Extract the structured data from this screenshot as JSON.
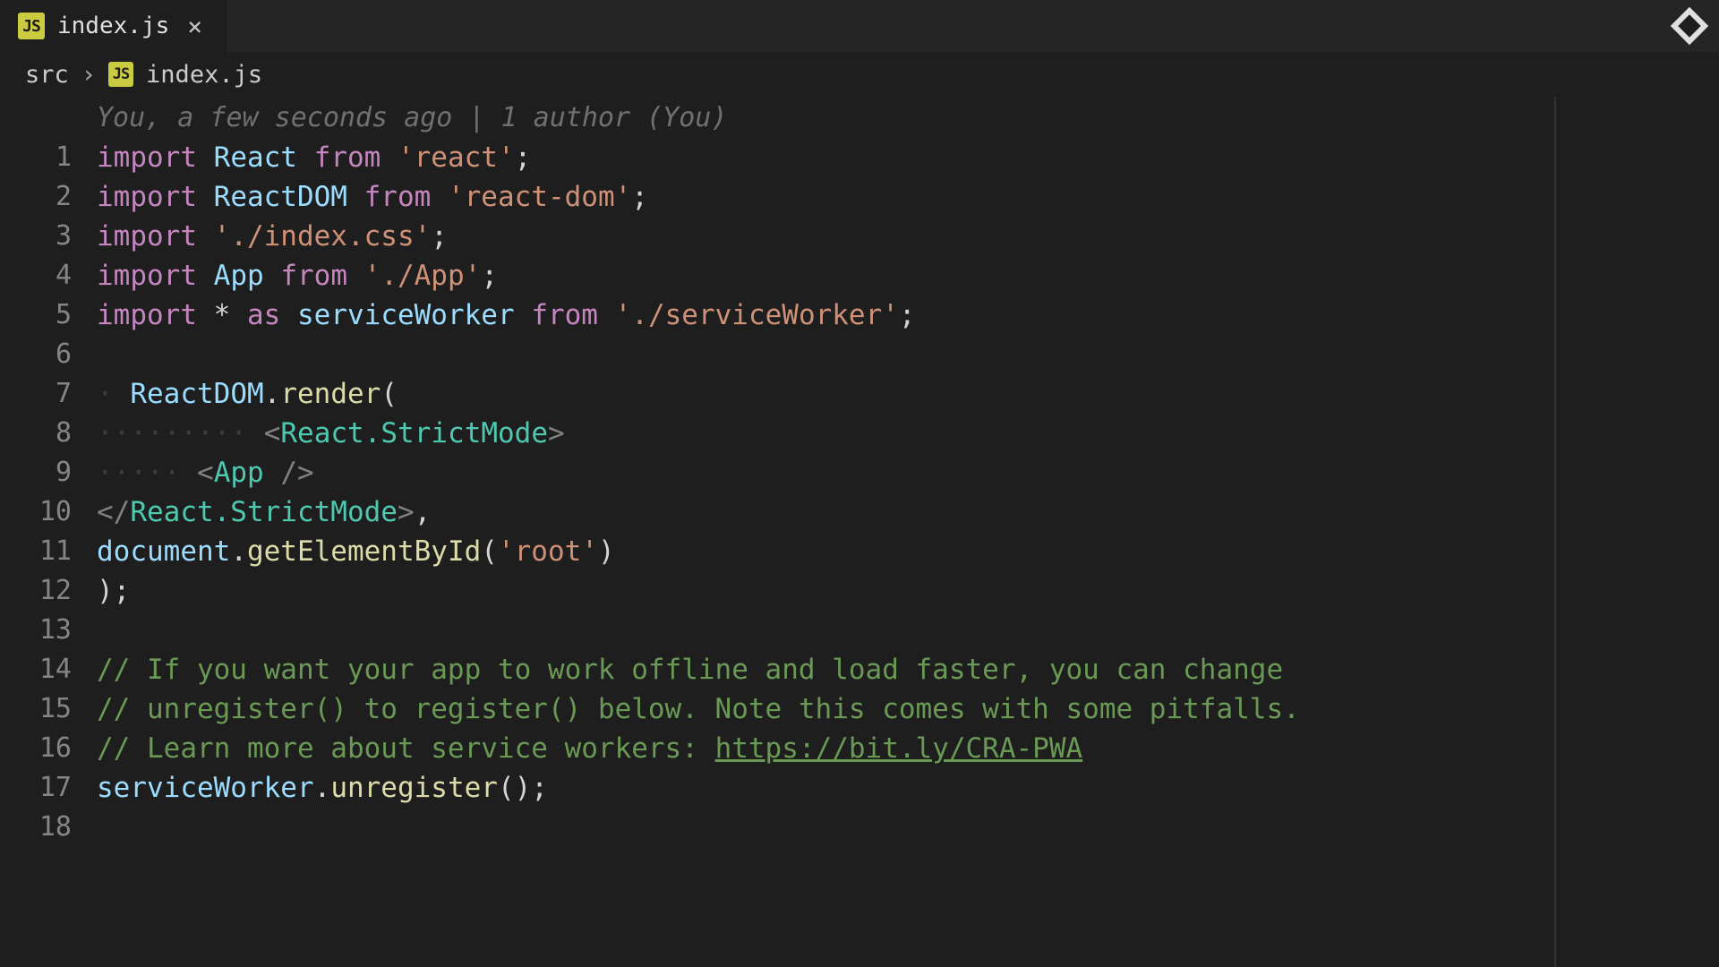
{
  "tab": {
    "icon_text": "JS",
    "label": "index.js"
  },
  "breadcrumb": {
    "folder": "src",
    "icon_text": "JS",
    "file": "index.js"
  },
  "blame": "You, a few seconds ago | 1 author (You)",
  "lines": {
    "n1": "1",
    "n2": "2",
    "n3": "3",
    "n4": "4",
    "n5": "5",
    "n6": "6",
    "n7": "7",
    "n8": "8",
    "n9": "9",
    "n10": "10",
    "n11": "11",
    "n12": "12",
    "n13": "13",
    "n14": "14",
    "n15": "15",
    "n16": "16",
    "n17": "17",
    "n18": "18"
  },
  "code": {
    "import": "import",
    "from": "from",
    "as": "as",
    "star": "*",
    "react_id": "React",
    "react_str": "'react'",
    "reactdom_id": "ReactDOM",
    "reactdom_str": "'react-dom'",
    "indexcss_str": "'./index.css'",
    "app_id": "App",
    "app_str": "'./App'",
    "sw_id": "serviceWorker",
    "sw_str": "'./serviceWorker'",
    "render": "render",
    "strictmode": "React.StrictMode",
    "document": "document",
    "getElem": "getElementById",
    "root_str": "'root'",
    "cmt1": "// If you want your app to work offline and load faster, you can change",
    "cmt2": "// unregister() to register() below. Note this comes with some pitfalls.",
    "cmt3a": "// Learn more about service workers: ",
    "cmt3b": "https://bit.ly/CRA-PWA",
    "unregister": "unregister",
    "semi": ";",
    "comma": ",",
    "paren_o": "(",
    "paren_c": ")",
    "lt": "<",
    "gt": ">",
    "ltc": "</",
    "sc": "/>",
    "dot": "."
  }
}
